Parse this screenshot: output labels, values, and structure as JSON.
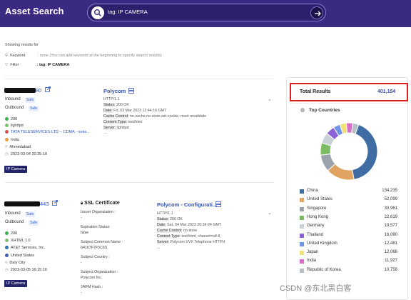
{
  "header": {
    "title": "Asset Search",
    "search_query": "tag: IP CAMERA"
  },
  "summary": {
    "showing_label": "Showing results for",
    "keyword_label": "Keyword",
    "keyword_value": ": none",
    "keyword_hint": "(You can add keyword at the beginning to specify search results)",
    "filter_label": "Filter",
    "filter_value": ": tag: IP CAMERA"
  },
  "results": [
    {
      "ip_suffix": "80",
      "inbound_label": "Inbound",
      "inbound_badge": "Safe",
      "outbound_label": "Outbound",
      "outbound_badge": "Safe",
      "details": [
        "200",
        "lighttpd",
        "TATA TELESERVICES LTD -- CDMA - netw...",
        "India",
        "Ahmedabad",
        "2023-03-04 20:35:10"
      ],
      "tag": "IP Camera",
      "service": {
        "title": "Polycom",
        "lines": [
          {
            "k": "",
            "v": "HTTP/1.1"
          },
          {
            "k": "Status:",
            "v": " 200 OK"
          },
          {
            "k": "Date:",
            "v": " Fri, 03 Mar 2023 12:44:16 GMT"
          },
          {
            "k": "Cache Control:",
            "v": " no-cache,no-store,set-cookie, must revalidate"
          },
          {
            "k": "Content Type:",
            "v": " text/html"
          },
          {
            "k": "Server:",
            "v": " lighttpd"
          },
          {
            "k": "",
            "v": "..."
          }
        ]
      }
    },
    {
      "ip_suffix": "443",
      "inbound_label": "Inbound",
      "inbound_badge": "Safe",
      "outbound_label": "Outbound",
      "outbound_badge": "Safe",
      "details": [
        "200",
        "XHTML 1.0",
        "AT&T Services, Inc.",
        "United States",
        "Daly City",
        "2023-03-05 16:15:16"
      ],
      "tag": "IP Camera",
      "ssl": {
        "title": "SSL Certificate",
        "lines": [
          "Issuer Organization :",
          "-",
          "Expiration Status:",
          "false",
          "Subject Common Name :",
          "64167F7F5C6S",
          "Subject Country :",
          "-",
          "Subject Organization :",
          "Polycom Inc.",
          "JARM Hash :",
          "-"
        ]
      },
      "service": {
        "title": "Polycom - Configurati...",
        "lines": [
          {
            "k": "",
            "v": "HTTP/1.1"
          },
          {
            "k": "Status:",
            "v": " 200 OK"
          },
          {
            "k": "Date:",
            "v": " Sat, 04 Mar 2023 20:34:24 GMT"
          },
          {
            "k": "Cache Control:",
            "v": " no-store"
          },
          {
            "k": "Content Type:",
            "v": " text/html; charset=utf-8"
          },
          {
            "k": "Server:",
            "v": " Polycom VVX Telephone HTTPd"
          },
          {
            "k": "",
            "v": "..."
          }
        ]
      }
    }
  ],
  "sidebar": {
    "total_label": "Total Results",
    "total_value": "401,154",
    "top_countries_label": "Top Countries",
    "countries": [
      {
        "name": "China",
        "count": "134,235",
        "value": 134235,
        "color": "#3f6da3"
      },
      {
        "name": "United States",
        "count": "52,099",
        "value": 52099,
        "color": "#e0a361"
      },
      {
        "name": "Singapore",
        "count": "30,961",
        "value": 30961,
        "color": "#9aa3ad"
      },
      {
        "name": "Hong Kong",
        "count": "22,619",
        "value": 22619,
        "color": "#7ebc63"
      },
      {
        "name": "Germany",
        "count": "19,577",
        "value": 19577,
        "color": "#c9d1d9"
      },
      {
        "name": "Thailand",
        "count": "16,090",
        "value": 16090,
        "color": "#8a63d6"
      },
      {
        "name": "United Kingdom",
        "count": "12,481",
        "value": 12481,
        "color": "#6f96e6"
      },
      {
        "name": "Japan",
        "count": "12,066",
        "value": 12066,
        "color": "#f2e079"
      },
      {
        "name": "India",
        "count": "11,927",
        "value": 11927,
        "color": "#d96ec9"
      },
      {
        "name": "Republic of Korea",
        "count": "10,756",
        "value": 10756,
        "color": "#b7bfc7"
      }
    ]
  },
  "watermark": "CSDN @东北黑白客",
  "colors": {
    "header_bg": "#3b2a82",
    "link": "#2b57c8",
    "highlight": "#e02020"
  }
}
